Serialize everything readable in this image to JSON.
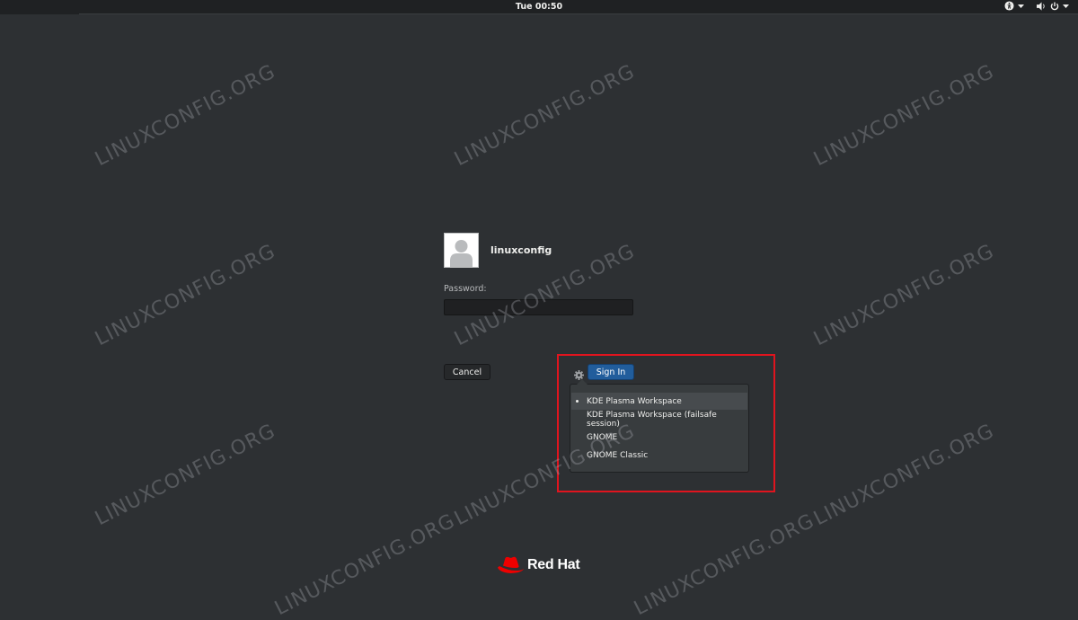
{
  "topbar": {
    "clock": "Tue 00:50"
  },
  "tray": {
    "accessibility_icon": "accessibility-icon",
    "volume_icon": "volume-icon",
    "power_icon": "power-icon"
  },
  "login": {
    "username": "linuxconfig",
    "password_label": "Password:",
    "password_value": "",
    "cancel_label": "Cancel",
    "signin_label": "Sign In"
  },
  "sessions": {
    "items": [
      {
        "label": "KDE Plasma Workspace",
        "selected": true
      },
      {
        "label": "KDE Plasma Workspace (failsafe session)",
        "selected": false
      },
      {
        "label": "GNOME",
        "selected": false
      },
      {
        "label": "GNOME Classic",
        "selected": false
      }
    ]
  },
  "branding": {
    "logo_text": "Red Hat",
    "logo_color": "#ee0000"
  },
  "watermark": {
    "text": "LINUXCONFIG.ORG"
  },
  "colors": {
    "background": "#2d3033",
    "signin_button": "#215d9c",
    "highlight_box": "#e0141e"
  }
}
